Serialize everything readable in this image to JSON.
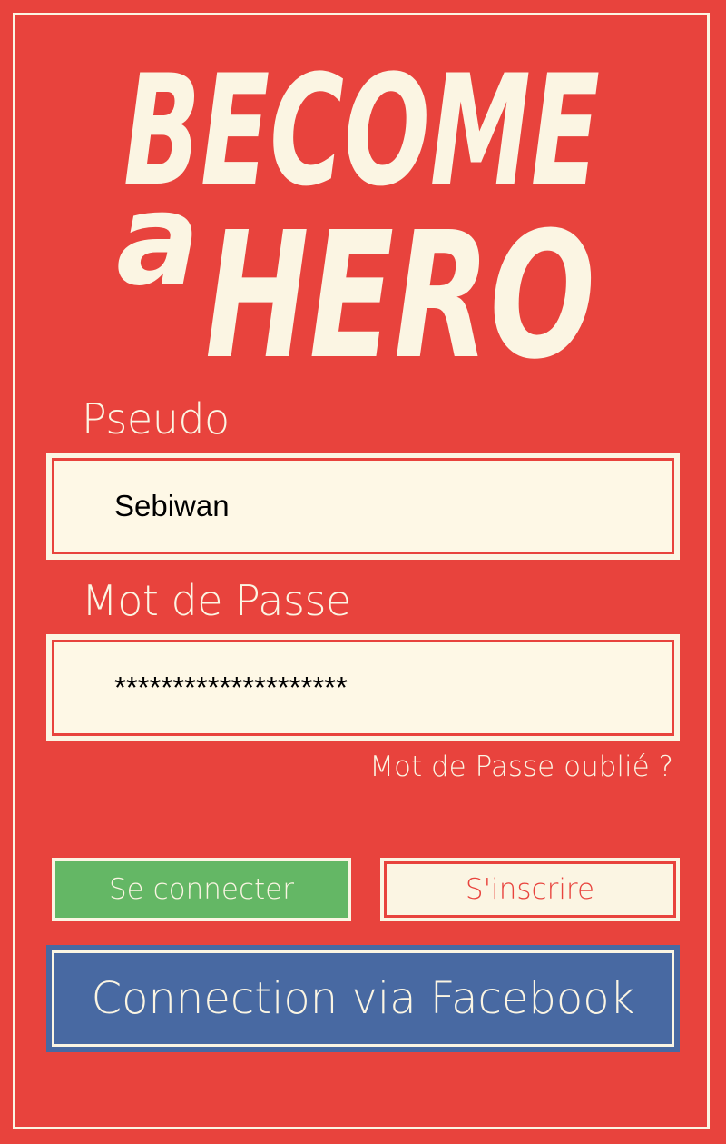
{
  "logo": {
    "line1": "BECOME",
    "small": "a",
    "line2": "HERO"
  },
  "username": {
    "label": "Pseudo",
    "value": "Sebiwan"
  },
  "password": {
    "label": "Mot de Passe",
    "value": "********************"
  },
  "forgot_link": "Mot de Passe oublié ?",
  "buttons": {
    "login": "Se connecter",
    "signup": "S'inscrire",
    "facebook": "Connection via Facebook"
  },
  "colors": {
    "background": "#e8433d",
    "cream": "#fbf5e3",
    "login_green": "#64b765",
    "facebook_blue": "#4869a2"
  }
}
